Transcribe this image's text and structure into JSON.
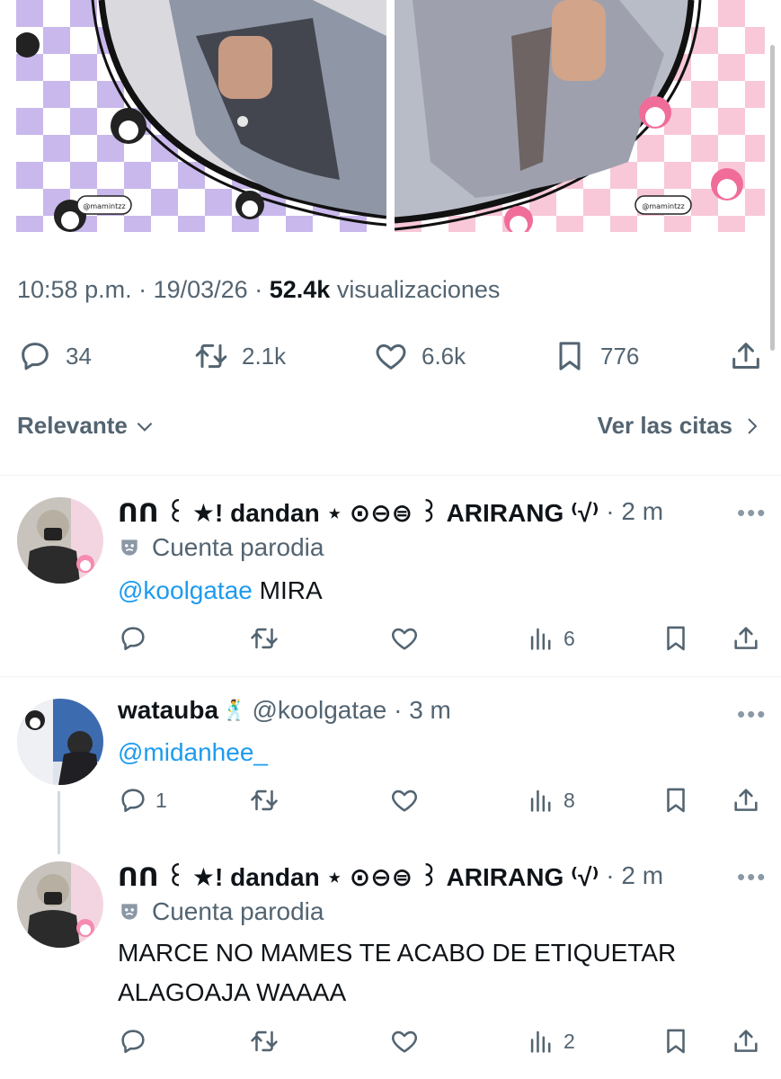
{
  "tweet": {
    "time": "10:58 p.m.",
    "date": "19/03/26",
    "views_count": "52.4k",
    "views_label": "visualizaciones",
    "watermark_left": "@mamintzz",
    "watermark_right": "@mamintzz",
    "stats": {
      "replies": "34",
      "retweets": "2.1k",
      "likes": "6.6k",
      "bookmarks": "776"
    }
  },
  "sort": {
    "left_label": "Relevante",
    "right_label": "Ver las citas"
  },
  "replies": [
    {
      "display_name": "ᑎᑎ ꒰ ★! dandan ⋆ ⊙⊖⊜ ꒱ ARIRANG ⁽√⁾",
      "time": "2 m",
      "parody_label": "Cuenta parodia",
      "mention": "@koolgatae",
      "text": " MIRA",
      "views": "6"
    },
    {
      "display_name": "watauba ꒰ᐢ⸝⸝•༝•⸝⸝ᐢ꒱",
      "name_short": "watauba",
      "name_emoji": "🕺",
      "handle": "@koolgatae",
      "time": "3 m",
      "mention": "@midanhee_",
      "replies": "1",
      "views": "8"
    },
    {
      "display_name": "ᑎᑎ ꒰ ★! dandan ⋆ ⊙⊖⊜ ꒱ ARIRANG ⁽√⁾",
      "time": "2 m",
      "parody_label": "Cuenta parodia",
      "text_line1": "MARCE NO MAMES TE ACABO DE ETIQUETAR",
      "text_line2": "ALAGOAJA WAAAA",
      "views": "2"
    }
  ],
  "colors": {
    "accent": "#1d9bf0",
    "muted": "#536471",
    "text": "#0f1419",
    "kuromi_purple": "#c9b8ec",
    "melody_pink": "#f8c8d8"
  }
}
